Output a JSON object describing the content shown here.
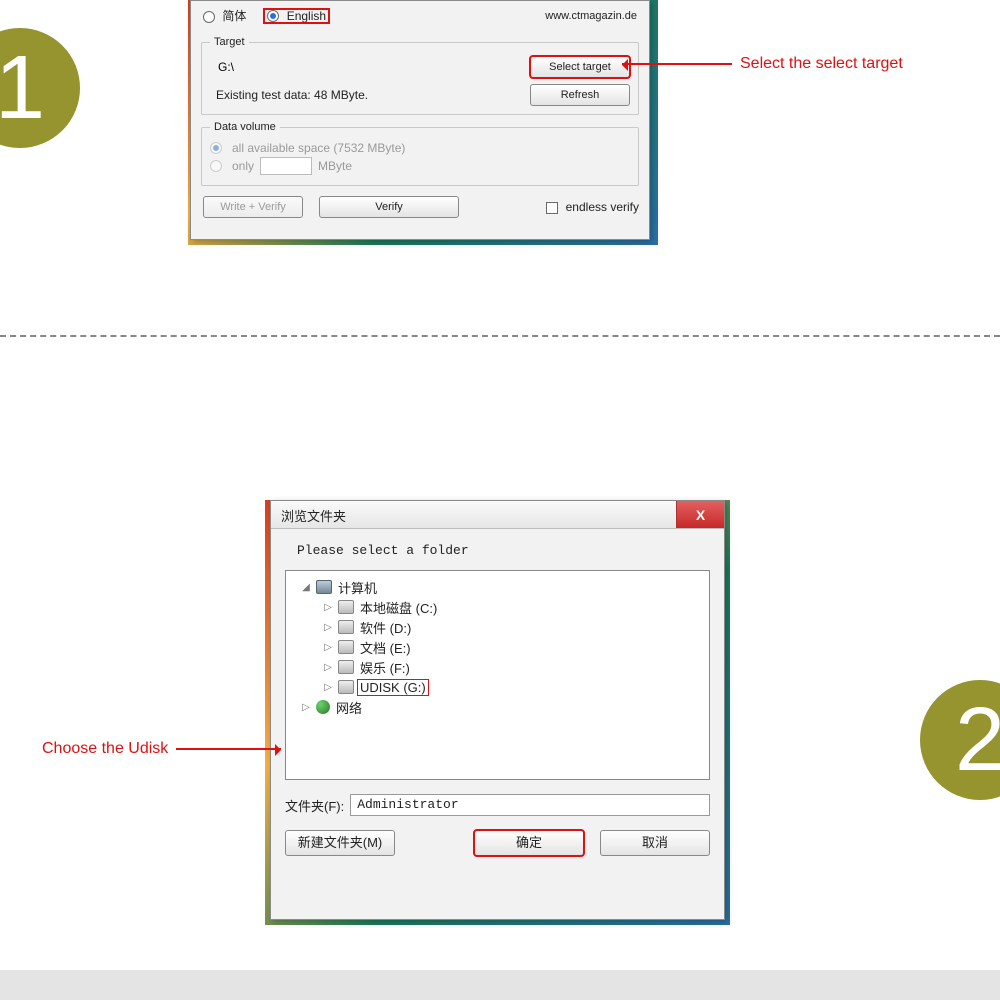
{
  "steps": {
    "one": "1",
    "two": "2"
  },
  "panel1": {
    "lang": {
      "opt_cn": "简体",
      "opt_en": "English",
      "site_url": "www.ctmagazin.de"
    },
    "target_group": {
      "legend": "Target",
      "drive": "G:\\",
      "select_btn": "Select target",
      "existing": "Existing test data: 48 MByte.",
      "refresh_btn": "Refresh"
    },
    "data_volume": {
      "legend": "Data volume",
      "opt_all": "all available space (7532 MByte)",
      "opt_only": "only",
      "unit": "MByte"
    },
    "actions": {
      "write_verify": "Write + Verify",
      "verify": "Verify",
      "endless": "endless verify"
    }
  },
  "annotation1": "Select the select target",
  "annotation2": "Choose the Udisk",
  "panel2": {
    "title": "浏览文件夹",
    "close": "X",
    "instruction": "Please select a folder",
    "tree": {
      "root": "计算机",
      "drives": [
        "本地磁盘 (C:)",
        "软件 (D:)",
        "文档 (E:)",
        "娱乐 (F:)",
        "UDISK (G:)"
      ],
      "network": "网络"
    },
    "folder_label": "文件夹(F):",
    "folder_value": "Administrator",
    "buttons": {
      "new_folder": "新建文件夹(M)",
      "ok": "确定",
      "cancel": "取消"
    }
  }
}
